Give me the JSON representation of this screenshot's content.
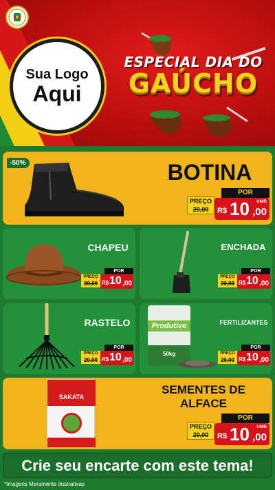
{
  "header": {
    "logo_line1": "Sua Logo",
    "logo_line2": "Aqui",
    "title_line1": "ESPECIAL DIA DO",
    "title_line2": "GAÚCHO"
  },
  "products": [
    {
      "name": "BOTINA",
      "discount": "-50%",
      "preco_label": "PREÇO",
      "old_price": "20,00",
      "por_label": "POR",
      "currency": "R$",
      "price_int": "10",
      "price_cents": ",00",
      "unit": "UNID"
    },
    {
      "name": "CHAPEU",
      "preco_label": "PREÇO",
      "old_price": "20,00",
      "por_label": "POR",
      "currency": "R$",
      "price_int": "10",
      "price_cents": ",00"
    },
    {
      "name": "ENCHADA",
      "preco_label": "PREÇO",
      "old_price": "20,00",
      "por_label": "POR",
      "currency": "R$",
      "price_int": "10",
      "price_cents": ",00"
    },
    {
      "name": "RASTELO",
      "preco_label": "PREÇO",
      "old_price": "20,00",
      "por_label": "POR",
      "currency": "R$",
      "price_int": "10",
      "price_cents": ",00"
    },
    {
      "name": "FERTILIZANTES",
      "preco_label": "PREÇO",
      "old_price": "20,00",
      "por_label": "POR",
      "currency": "R$",
      "price_int": "10",
      "price_cents": ",00",
      "package_brand": "Produtive",
      "package_weight": "50kg"
    },
    {
      "name_line1": "SEMENTES DE",
      "name_line2": "ALFACE",
      "preco_label": "PREÇO",
      "old_price": "20,00",
      "por_label": "POR",
      "currency": "R$",
      "price_int": "10",
      "price_cents": ",00",
      "unit": "UNID",
      "package_brand": "SAKATA"
    }
  ],
  "cta": "Crie seu encarte com este tema!",
  "footnote": "*Imagens Meramente Ilustrativas",
  "colors": {
    "red": "#d6131a",
    "yellow": "#f1b51b",
    "green": "#23903a",
    "dark_green": "#1a6d2a",
    "gold": "#f5d31b"
  }
}
